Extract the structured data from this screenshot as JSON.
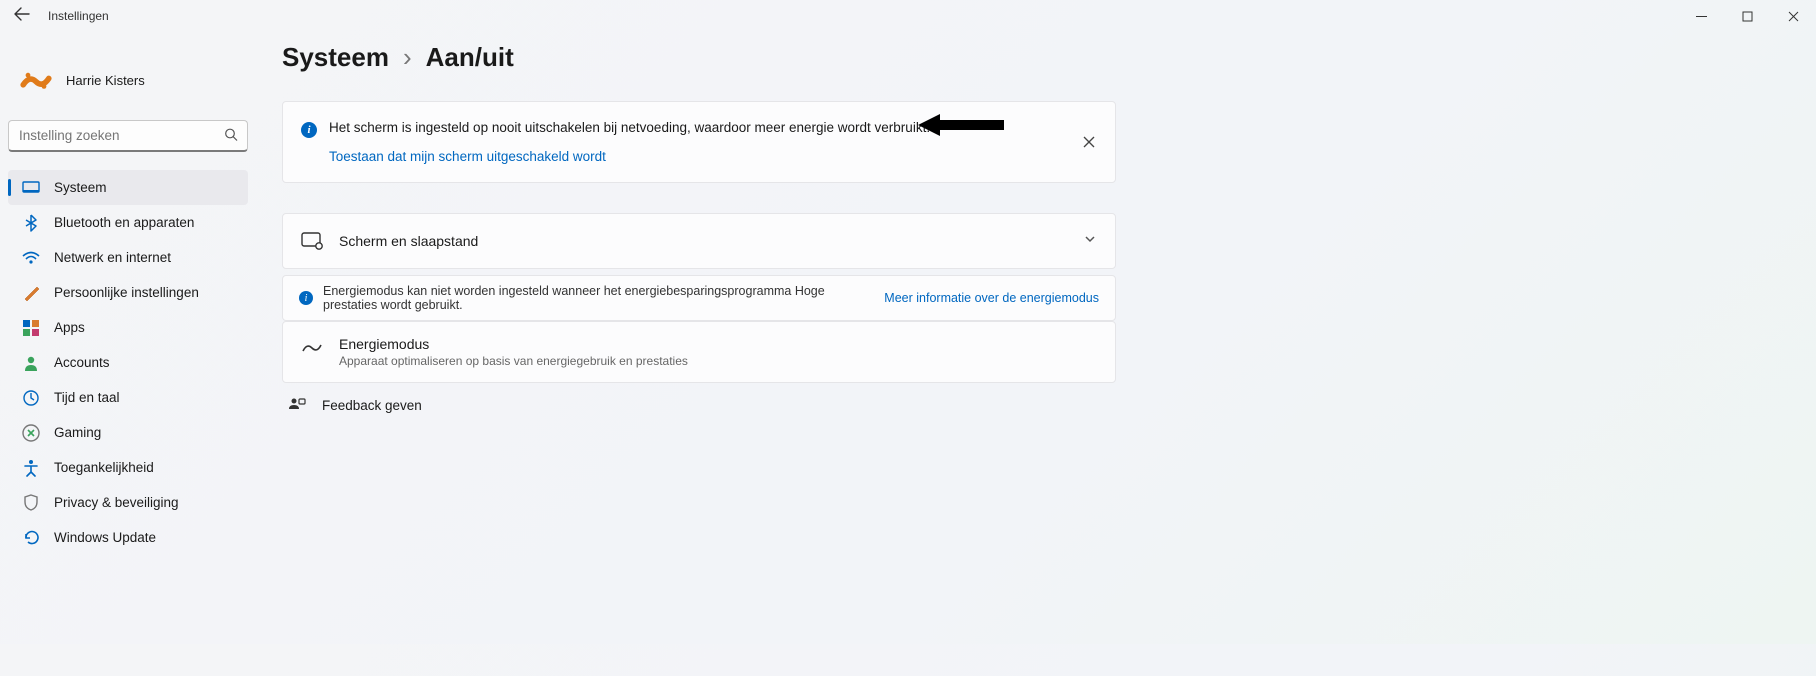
{
  "window": {
    "app_title": "Instellingen"
  },
  "user": {
    "name": "Harrie Kisters"
  },
  "search": {
    "placeholder": "Instelling zoeken"
  },
  "nav": {
    "items": [
      {
        "label": "Systeem"
      },
      {
        "label": "Bluetooth en apparaten"
      },
      {
        "label": "Netwerk en internet"
      },
      {
        "label": "Persoonlijke instellingen"
      },
      {
        "label": "Apps"
      },
      {
        "label": "Accounts"
      },
      {
        "label": "Tijd en taal"
      },
      {
        "label": "Gaming"
      },
      {
        "label": "Toegankelijkheid"
      },
      {
        "label": "Privacy & beveiliging"
      },
      {
        "label": "Windows Update"
      }
    ]
  },
  "breadcrumb": {
    "parent": "Systeem",
    "sep": "›",
    "current": "Aan/uit"
  },
  "info_banner": {
    "text": "Het scherm is ingesteld op nooit uitschakelen bij netvoeding, waardoor meer energie wordt verbruikt.",
    "link": "Toestaan dat mijn scherm uitgeschakeld wordt"
  },
  "settings": {
    "screen_sleep": "Scherm en slaapstand"
  },
  "warning_strip": {
    "text": "Energiemodus kan niet worden ingesteld wanneer het energiebesparingsprogramma Hoge prestaties wordt gebruikt.",
    "link": "Meer informatie over de energiemodus"
  },
  "energy_mode": {
    "title": "Energiemodus",
    "subtitle": "Apparaat optimaliseren op basis van energiegebruik en prestaties"
  },
  "feedback": {
    "label": "Feedback geven"
  }
}
